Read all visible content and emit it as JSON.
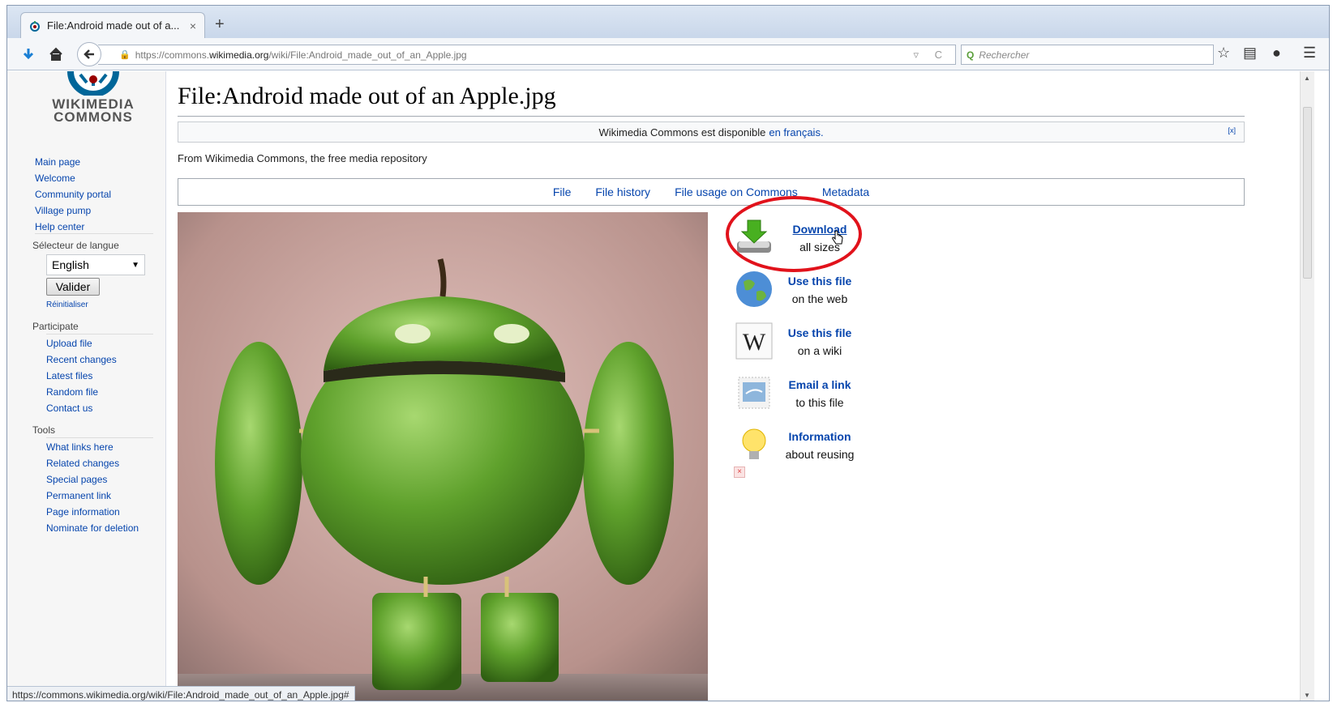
{
  "browser": {
    "tab_title": "File:Android made out of a...",
    "tab_close": "×",
    "new_tab": "+",
    "url_prefix": "https://commons.",
    "url_domain": "wikimedia.org",
    "url_path": "/wiki/File:Android_made_out_of_an_Apple.jpg",
    "url_actions": "▿ C",
    "search_placeholder": "Rechercher",
    "status_url": "https://commons.wikimedia.org/wiki/File:Android_made_out_of_an_Apple.jpg#"
  },
  "logo": {
    "line1": "WIKIMEDIA",
    "line2": "COMMONS"
  },
  "sidebar": {
    "nav": [
      "Main page",
      "Welcome",
      "Community portal",
      "Village pump",
      "Help center"
    ],
    "lang_heading": "Sélecteur de langue",
    "lang_selected": "English",
    "valider": "Valider",
    "reinitialiser": "Réinitialiser",
    "participate_heading": "Participate",
    "participate": [
      "Upload file",
      "Recent changes",
      "Latest files",
      "Random file",
      "Contact us"
    ],
    "tools_heading": "Tools",
    "tools": [
      "What links here",
      "Related changes",
      "Special pages",
      "Permanent link",
      "Page information",
      "Nominate for deletion"
    ]
  },
  "page": {
    "title": "File:Android made out of an Apple.jpg",
    "notice_text": "Wikimedia Commons est disponible",
    "notice_link": "en français.",
    "notice_dismiss": "[x]",
    "sitesub": "From Wikimedia Commons, the free media repository",
    "filetoc": [
      "File",
      "File history",
      "File usage on Commons",
      "Metadata"
    ]
  },
  "actions": [
    {
      "title": "Download",
      "sub": "all sizes",
      "icon": "download-icon"
    },
    {
      "title": "Use this file",
      "sub": "on the web",
      "icon": "globe-icon"
    },
    {
      "title": "Use this file",
      "sub": "on a wiki",
      "icon": "wikipedia-w-icon"
    },
    {
      "title": "Email a link",
      "sub": "to this file",
      "icon": "email-stamp-icon"
    },
    {
      "title": "Information",
      "sub": "about reusing",
      "icon": "lightbulb-icon"
    }
  ],
  "colors": {
    "link": "#0645ad",
    "highlight_circle": "#e1121b",
    "apple_green": "#5fa12c"
  }
}
